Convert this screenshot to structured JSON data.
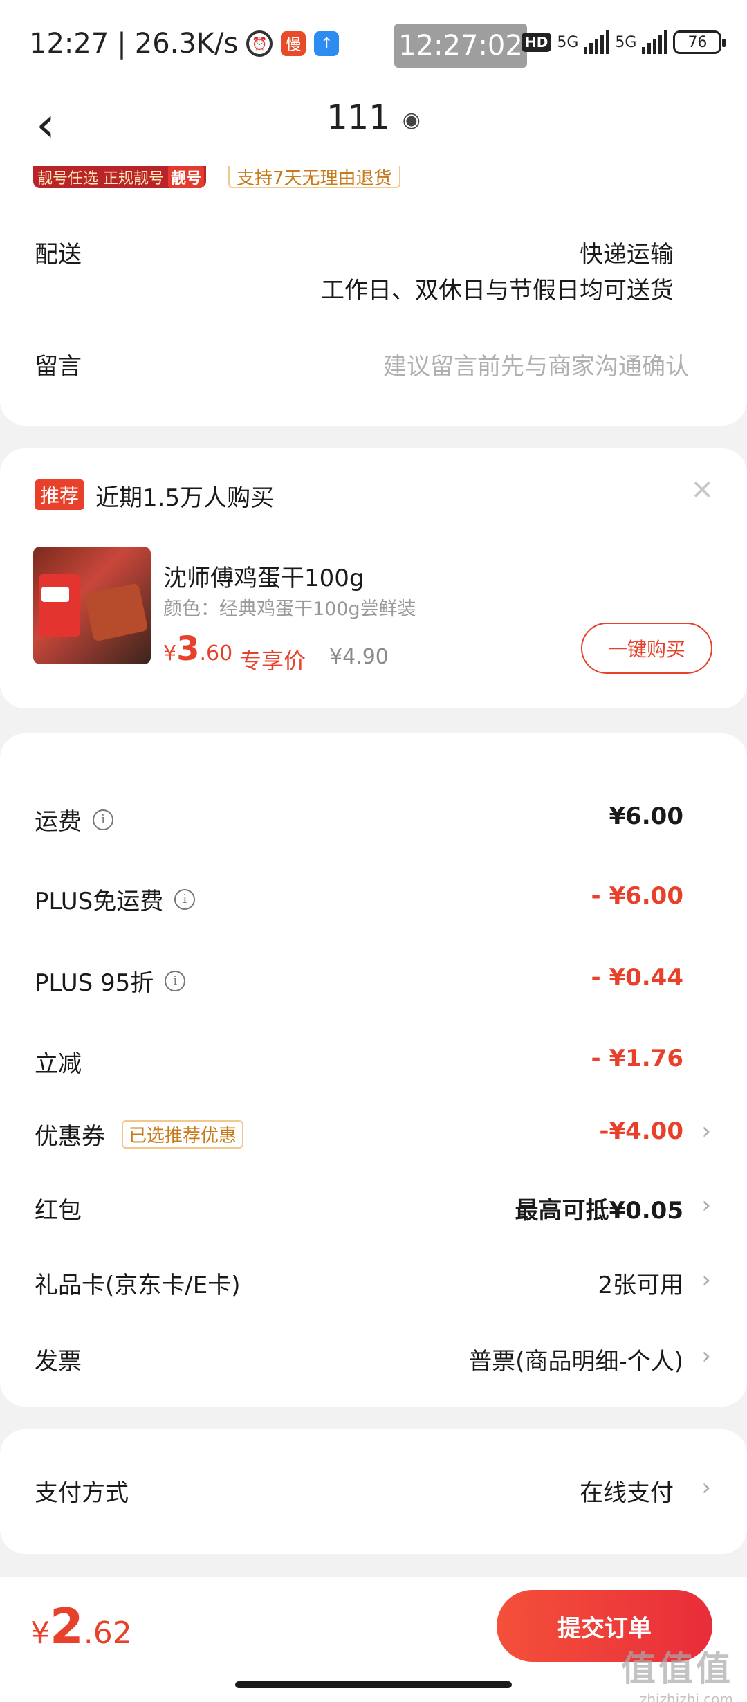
{
  "status_bar": {
    "time": "12:27",
    "speed": "26.3K/s",
    "slow_icon_text": "慢",
    "clock": "12:27:02",
    "hd": "HD",
    "net1": "5G",
    "net2": "5G",
    "battery": "76"
  },
  "nav": {
    "title": "111"
  },
  "top_card": {
    "banner_text": "靓号任选 正规靓号",
    "banner_tag": "靓号",
    "return_tag": "支持7天无理由退货",
    "delivery_label": "配送",
    "delivery_method": "快递运输",
    "delivery_time": "工作日、双休日与节假日均可送货",
    "message_label": "留言",
    "message_placeholder": "建议留言前先与商家沟通确认"
  },
  "recommend": {
    "tag": "推荐",
    "title": "近期1.5万人购买",
    "product_name": "沈师傅鸡蛋干100g",
    "product_spec": "颜色：经典鸡蛋干100g尝鲜装",
    "price_symbol": "¥",
    "price_int": "3",
    "price_dec": ".60",
    "exclusive": "专享价",
    "original_price": "¥4.90",
    "buy_button": "一键购买"
  },
  "fees": [
    {
      "label": "运费",
      "value": "¥6.00"
    },
    {
      "label": "PLUS免运费",
      "value": "- ¥6.00"
    },
    {
      "label": "PLUS 95折",
      "value": "- ¥0.44"
    },
    {
      "label": "立减",
      "value": "- ¥1.76"
    },
    {
      "label": "优惠券",
      "tag": "已选推荐优惠",
      "value": "-¥4.00"
    },
    {
      "label": "红包",
      "value": "最高可抵¥0.05"
    },
    {
      "label": "礼品卡(京东卡/E卡)",
      "value": "2张可用"
    },
    {
      "label": "发票",
      "value": "普票(商品明细-个人)"
    }
  ],
  "payment": {
    "label": "支付方式",
    "value": "在线支付"
  },
  "bottom": {
    "symbol": "¥",
    "int": "2",
    "dec": ".62",
    "submit": "提交订单"
  },
  "watermark": {
    "logo": "值值值",
    "url": "zhizhizhi.com"
  },
  "colors": {
    "accent": "#e8412b",
    "tag_border": "#f1c98c",
    "tag_text": "#c77a1a"
  }
}
